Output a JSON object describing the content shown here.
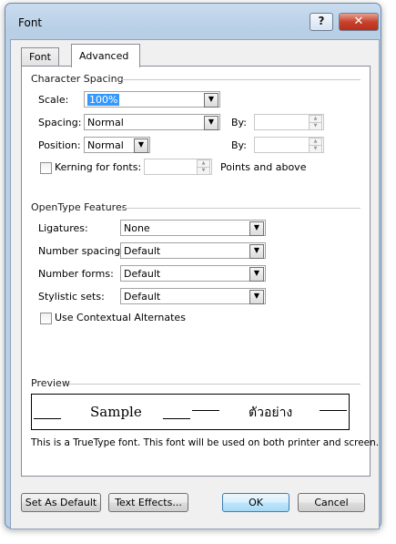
{
  "window": {
    "title": "Font",
    "help_glyph": "?",
    "close_glyph": "✕"
  },
  "tabs": [
    {
      "label": "Font",
      "accel": "n"
    },
    {
      "label": "Advanced",
      "accel": "v"
    }
  ],
  "character_spacing": {
    "title": "Character Spacing",
    "scale": {
      "label": "Scale:",
      "value": "100%"
    },
    "spacing": {
      "label": "Spacing:",
      "value": "Normal",
      "by_label": "By:",
      "by_value": ""
    },
    "position": {
      "label": "Position:",
      "value": "Normal",
      "by_label": "By:",
      "by_value": ""
    },
    "kerning": {
      "label": "Kerning for fonts:",
      "checked": false,
      "value": "",
      "suffix": "Points and above"
    }
  },
  "opentype": {
    "title": "OpenType Features",
    "ligatures": {
      "label": "Ligatures:",
      "value": "None"
    },
    "number_spacing": {
      "label": "Number spacing:",
      "value": "Default"
    },
    "number_forms": {
      "label": "Number forms:",
      "value": "Default"
    },
    "stylistic_sets": {
      "label": "Stylistic sets:",
      "value": "Default"
    },
    "contextual": {
      "label": "Use Contextual Alternates",
      "checked": false
    }
  },
  "preview": {
    "title": "Preview",
    "sample_latin": "Sample",
    "sample_thai": "ตัวอย่าง",
    "description": "This is a TrueType font. This font will be used on both printer and screen."
  },
  "buttons": {
    "set_default": "Set As Default",
    "text_effects": "Text Effects...",
    "ok": "OK",
    "cancel": "Cancel"
  },
  "colors": {
    "selection": "#3399ff",
    "close_button": "#c8422c",
    "frame": "#b9cfe6"
  }
}
